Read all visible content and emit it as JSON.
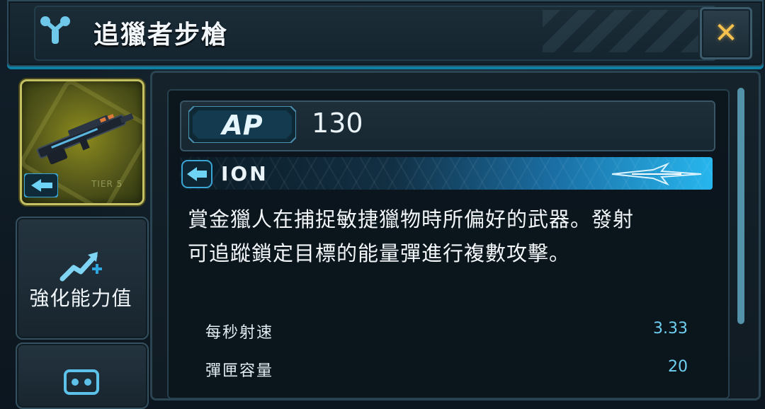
{
  "header": {
    "title": "追獵者步槍",
    "close_icon": "close-x-icon"
  },
  "weapon": {
    "card_bg_color": "#8d8c1e",
    "element_icon": "ion-arrow-icon",
    "tier_text": "TIER 5"
  },
  "sidebar": {
    "upgrade_label": "強化能力值",
    "upgrade_icon": "upgrade-arrow-plus-icon",
    "mod_icon": "mod-chip-icon"
  },
  "ap": {
    "badge_text": "AP",
    "value": "130"
  },
  "damage_type": {
    "label": "ION",
    "accent_color": "#27b6ee"
  },
  "description": "賞金獵人在捕捉敏捷獵物時所偏好的武器。發射可追蹤鎖定目標的能量彈進行複數攻擊。",
  "stats": [
    {
      "label": "每秒射速",
      "value": "3.33"
    },
    {
      "label": "彈匣容量",
      "value": "20"
    }
  ]
}
